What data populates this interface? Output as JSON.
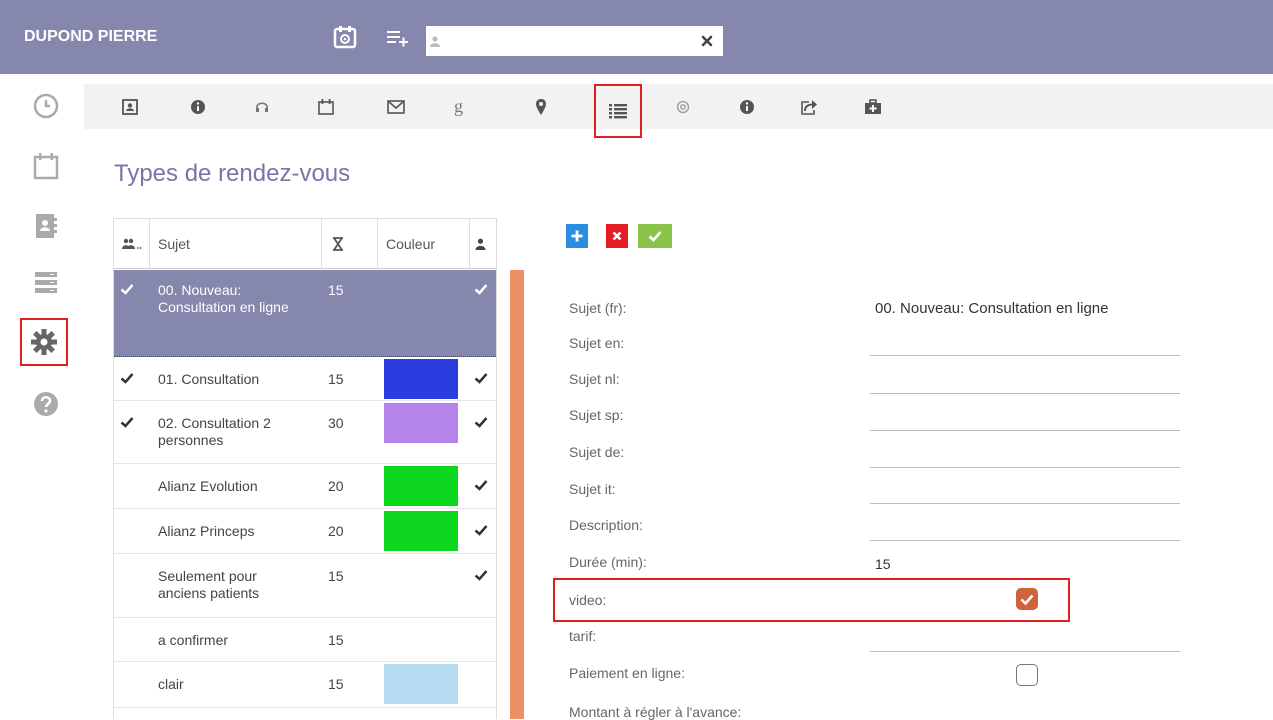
{
  "header": {
    "user_name": "DUPOND PIERRE",
    "search_value": "",
    "search_placeholder": ""
  },
  "page": {
    "title": "Types de rendez-vous"
  },
  "table": {
    "columns": [
      "Sujet",
      "Couleur"
    ],
    "rows": [
      {
        "checked": true,
        "subject": "00. Nouveau: Consultation en ligne",
        "duration": "15",
        "color": "",
        "active": true,
        "selected": true
      },
      {
        "checked": true,
        "subject": "01. Consultation",
        "duration": "15",
        "color": "#2a3ee0",
        "active": true,
        "selected": false
      },
      {
        "checked": true,
        "subject": "02. Consultation 2 personnes",
        "duration": "30",
        "color": "#b584ea",
        "active": true,
        "selected": false
      },
      {
        "checked": false,
        "subject": "Alianz Evolution",
        "duration": "20",
        "color": "#0dd61f",
        "active": true,
        "selected": false
      },
      {
        "checked": false,
        "subject": "Alianz Princeps",
        "duration": "20",
        "color": "#0dd61f",
        "active": true,
        "selected": false
      },
      {
        "checked": false,
        "subject": "Seulement pour anciens patients",
        "duration": "15",
        "color": "",
        "active": true,
        "selected": false
      },
      {
        "checked": false,
        "subject": "a confirmer",
        "duration": "15",
        "color": "",
        "active": false,
        "selected": false
      },
      {
        "checked": false,
        "subject": "clair",
        "duration": "15",
        "color": "#b5dcf0",
        "active": false,
        "selected": false
      }
    ]
  },
  "form": {
    "sujet_fr_label": "Sujet (fr):",
    "sujet_fr_value": "00. Nouveau: Consultation en ligne",
    "sujet_en_label": "Sujet en:",
    "sujet_nl_label": "Sujet nl:",
    "sujet_sp_label": "Sujet sp:",
    "sujet_de_label": "Sujet de:",
    "sujet_it_label": "Sujet it:",
    "description_label": "Description:",
    "duree_label": "Durée (min):",
    "duree_value": "15",
    "video_label": "video:",
    "video_checked": true,
    "tarif_label": "tarif:",
    "paiement_label": "Paiement en ligne:",
    "paiement_checked": false,
    "montant_label": "Montant à régler à l'avance:"
  },
  "colors": {
    "header_bg": "#8587ad",
    "accent": "#7677a8",
    "selected_row": "#8587ad",
    "checkbox_on": "#d0633c",
    "highlight": "#e02020",
    "scrollbar": "#ee8f66",
    "btn_add": "#2b8de0",
    "btn_delete": "#e51c23",
    "btn_ok": "#8bc34a"
  },
  "icons": {
    "header": [
      "calendar-settings-icon",
      "add-list-icon"
    ],
    "sidebar": [
      "clock-icon",
      "calendar-icon",
      "address-book-icon",
      "server-icon",
      "gear-icon",
      "help-icon"
    ],
    "toolbar": [
      "contact-card-icon",
      "info-icon",
      "headset-icon",
      "calendar-icon",
      "envelope-icon",
      "google-icon",
      "map-marker-icon",
      "list-icon",
      "at-icon",
      "info-icon",
      "share-icon",
      "medical-kit-icon"
    ]
  }
}
